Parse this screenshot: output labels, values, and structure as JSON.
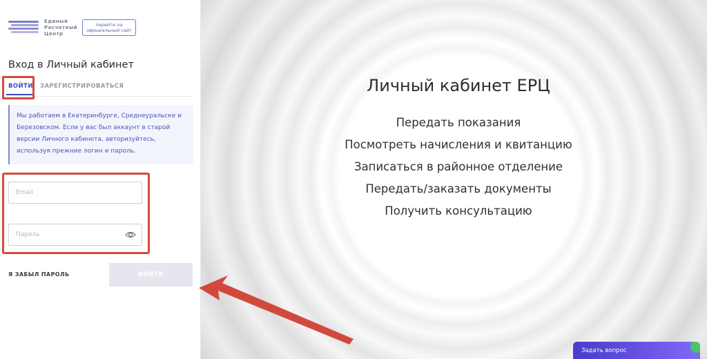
{
  "logo": {
    "text_lines": [
      "Единый",
      "Расчетный",
      "Центр"
    ]
  },
  "official_site": {
    "lines": [
      "перейти на",
      "официальный сайт"
    ]
  },
  "login": {
    "title": "Вход в Личный кабинет",
    "tabs": [
      {
        "label": "ВОЙТИ",
        "active": true
      },
      {
        "label": "ЗАРЕГИСТРИРОВАТЬСЯ",
        "active": false
      }
    ],
    "info": "Мы работаем в Екатеринбурге, Среднеуральске и Березовском. Если у вас был аккаунт в старой версии Личного кабинета, авторизуйтесь, используя прежние логин и пароль.",
    "email": {
      "placeholder": "Email",
      "value": ""
    },
    "password": {
      "placeholder": "Пароль",
      "value": ""
    },
    "forgot_label": "Я ЗАБЫЛ ПАРОЛЬ",
    "submit_label": "ВОЙТИ"
  },
  "hero": {
    "title": "Личный кабинет ЕРЦ",
    "items": [
      "Передать показания",
      "Посмотреть начисления и квитанцию",
      "Записаться в районное отделение",
      "Передать/заказать документы",
      "Получить консультацию"
    ]
  },
  "chat": {
    "label": "Задать вопрос"
  },
  "colors": {
    "accent": "#3b4bc2",
    "highlight": "#d14b3e",
    "chat": "#5a48da"
  },
  "icons": [
    "logo-stripes-icon",
    "eye-icon",
    "annotation-arrow-icon"
  ]
}
